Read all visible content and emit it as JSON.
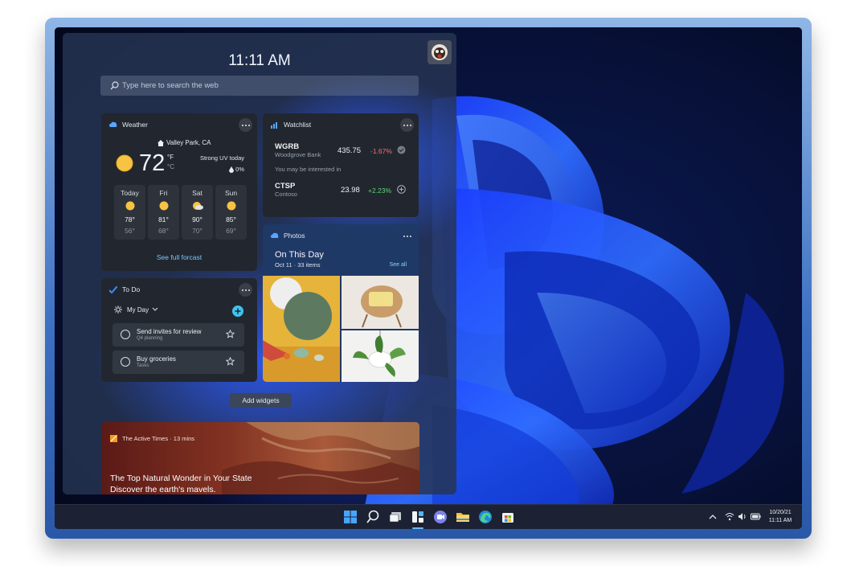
{
  "panel": {
    "clock": "11:11 AM",
    "search_placeholder": "Type here to search the web",
    "add_widgets_label": "Add widgets"
  },
  "weather": {
    "title": "Weather",
    "location": "Valley Park, CA",
    "temp": "72",
    "unit_f": "°F",
    "unit_c": "°C",
    "condition": "Strong UV today",
    "precip": "0%",
    "days": [
      {
        "name": "Today",
        "high": "78°",
        "low": "56°"
      },
      {
        "name": "Fri",
        "high": "81°",
        "low": "68°"
      },
      {
        "name": "Sat",
        "high": "90°",
        "low": "70°"
      },
      {
        "name": "Sun",
        "high": "85°",
        "low": "69°"
      }
    ],
    "forecast_link": "See full forcast"
  },
  "watchlist": {
    "title": "Watchlist",
    "stocks": [
      {
        "symbol": "WGRB",
        "company": "Woodgrove Bank",
        "price": "435.75",
        "change": "-1.67%"
      },
      {
        "symbol": "CTSP",
        "company": "Contoso",
        "price": "23.98",
        "change": "+2.23%"
      }
    ],
    "interested_label": "You may be interested in"
  },
  "photos": {
    "title": "Photos",
    "heading": "On This Day",
    "subheading": "Oct 11 · 33 items",
    "see_all": "See all"
  },
  "todo": {
    "title": "To Do",
    "list_name": "My Day",
    "tasks": [
      {
        "title": "Send invites for review",
        "sub": "Q4 planning"
      },
      {
        "title": "Buy groceries",
        "sub": "Tasks"
      }
    ]
  },
  "news": {
    "source": "The Active Times · 13 mins",
    "headline_line1": "The Top Natural Wonder in Your State",
    "headline_line2": "Discover the earth's mavels."
  },
  "taskbar": {
    "icons": [
      "start-icon",
      "search-icon",
      "task-view-icon",
      "widgets-icon",
      "chat-icon",
      "file-explorer-icon",
      "edge-icon",
      "store-icon"
    ],
    "date": "10/20/21",
    "time": "11:11 AM"
  },
  "colors": {
    "negative": "#ff6b6b",
    "positive": "#5fd37b",
    "accent": "#3fc3ee",
    "link": "#6ec1ff"
  }
}
